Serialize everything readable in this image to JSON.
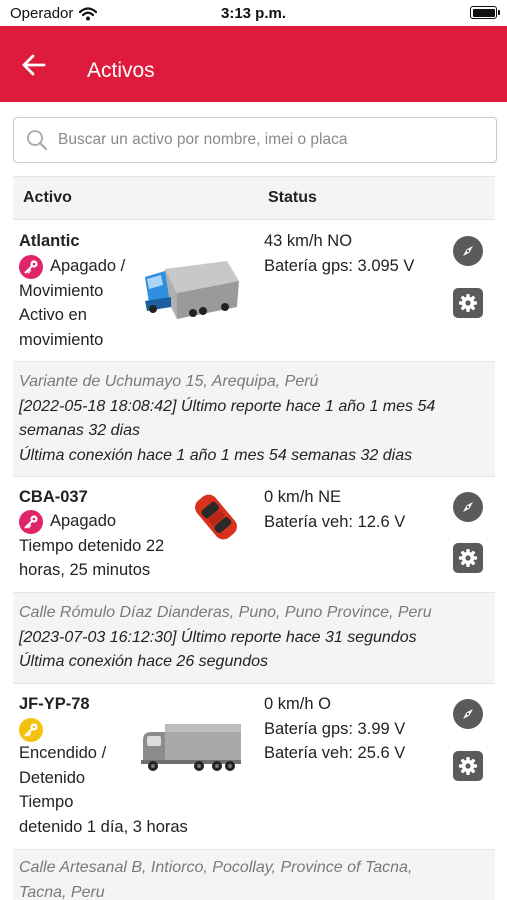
{
  "status_bar": {
    "carrier": "Operador",
    "time": "3:13 p.m.",
    "icons": [
      "wifi-icon",
      "battery-icon"
    ]
  },
  "header": {
    "title": "Activos",
    "back_icon": "arrow-left-icon",
    "background": "#de1b3d"
  },
  "search": {
    "placeholder": "Buscar un activo por nombre, imei o placa",
    "value": ""
  },
  "table": {
    "col_asset": "Activo",
    "col_status": "Status"
  },
  "colors": {
    "ignition_off": "#e0246a",
    "ignition_on": "#f2c20f",
    "button_gray": "#5a5a5a"
  },
  "assets": [
    {
      "name": "Atlantic",
      "key_state": "off",
      "state_lines": [
        "Apagado /",
        "Movimiento",
        "Activo en",
        "movimiento"
      ],
      "vehicle_icon": "blue-truck",
      "status_lines": [
        "43 km/h NO",
        "Batería gps: 3.095 V"
      ],
      "address": "Variante de Uchumayo 15, Arequipa, Perú",
      "report_lines": [
        "[2022-05-18 18:08:42] Último reporte hace 1 año 1 mes 54",
        "semanas 32 dias",
        "Última conexión hace 1 año 1 mes 54 semanas 32 dias"
      ]
    },
    {
      "name": "CBA-037",
      "key_state": "off",
      "state_lines": [
        "Apagado",
        "Tiempo detenido 22",
        "horas, 25 minutos"
      ],
      "vehicle_icon": "red-car",
      "status_lines": [
        "0 km/h NE",
        "Batería veh: 12.6 V"
      ],
      "address": "Calle Rómulo Díaz Dianderas, Puno, Puno Province, Peru",
      "report_lines": [
        "[2023-07-03 16:12:30] Último reporte hace 31 segundos",
        "Última conexión hace 26 segundos"
      ]
    },
    {
      "name": "JF-YP-78",
      "key_state": "on",
      "state_lines": [
        "Encendido /",
        "Detenido",
        "Tiempo",
        "detenido 1 día, 3 horas"
      ],
      "vehicle_icon": "gray-truck",
      "status_lines": [
        "0 km/h O",
        "Batería gps: 3.99 V",
        "Batería veh: 25.6 V"
      ],
      "address_lines": [
        "Calle Artesanal B, Intiorco, Pocollay, Province of Tacna,",
        "Tacna, Peru"
      ]
    }
  ]
}
